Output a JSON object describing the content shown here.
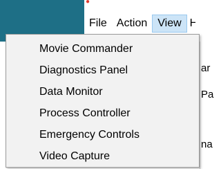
{
  "menubar": {
    "items": [
      {
        "label": "File"
      },
      {
        "label": "Action"
      },
      {
        "label": "View"
      },
      {
        "label": "H"
      }
    ],
    "active_index": 2
  },
  "view_menu": {
    "items": [
      {
        "label": "Movie Commander"
      },
      {
        "label": "Diagnostics Panel"
      },
      {
        "label": "Data Monitor"
      },
      {
        "label": "Process Controller"
      },
      {
        "label": "Emergency Controls"
      },
      {
        "label": "Video Capture"
      }
    ]
  },
  "background": {
    "fragments": [
      "ar",
      "Pa",
      "",
      "na"
    ]
  },
  "colors": {
    "panel": "#1e6f86",
    "active_menu_bg": "#cce4f7",
    "active_menu_border": "#99c9ef",
    "dropdown_bg": "#f2f2f2"
  }
}
